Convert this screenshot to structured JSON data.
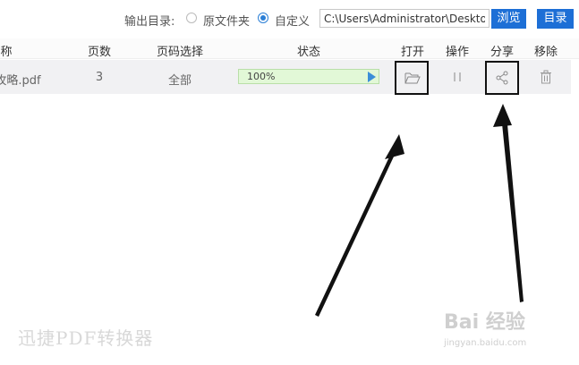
{
  "topbar": {
    "output_label": "输出目录:",
    "radio_original": "原文件夹",
    "radio_custom": "自定义",
    "path_value": "C:\\Users\\Administrator\\Deskto",
    "browse_label": "浏览",
    "directory_label": "目录"
  },
  "table": {
    "columns": [
      "称",
      "页数",
      "页码选择",
      "状态",
      "打开",
      "操作",
      "分享",
      "移除"
    ],
    "row": {
      "filename": "攻略.pdf",
      "pages": "3",
      "page_selection": "全部",
      "progress_text": "100%",
      "progress": 1.0
    }
  },
  "watermark": {
    "app_name": "迅捷PDF转换器",
    "baidu_main": "Bai 经验",
    "baidu_sub": "jingyan.baidu.com"
  },
  "icons": {
    "open": "folder-open-icon",
    "pause": "pause-icon",
    "share": "share-icon",
    "remove": "trash-icon"
  },
  "colors": {
    "accent": "#1d6fd6",
    "progress_fill": "#e2f8d7",
    "row_bg": "#f1f1f3"
  }
}
